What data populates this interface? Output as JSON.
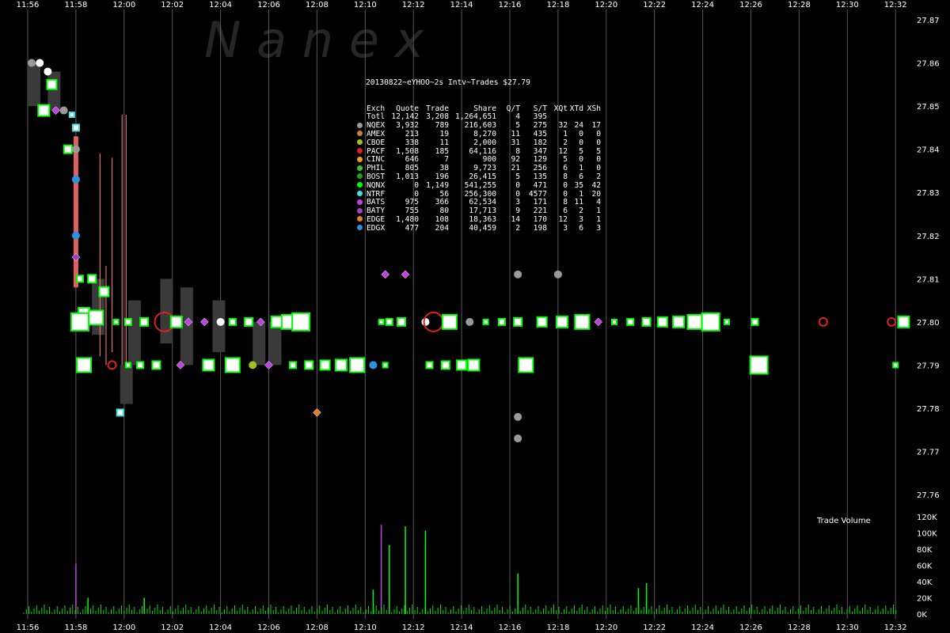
{
  "watermark": "N a n e x",
  "stats": {
    "title": "20130822~eYHOO~2s Intv~Trades $27.79",
    "columns": [
      "Exch",
      "Quote",
      "Trade",
      "Share",
      "Q/T",
      "S/T",
      "XQt",
      "XTd",
      "XSh"
    ],
    "rows": [
      {
        "exch": "Totl",
        "color": "",
        "quote": "12,142",
        "trade": "3,208",
        "share": "1,264,651",
        "qt": "4",
        "st": "395",
        "xqt": "",
        "xtd": "",
        "xsh": ""
      },
      {
        "exch": "NQEX",
        "color": "#9a9a9a",
        "quote": "3,932",
        "trade": "789",
        "share": "216,603",
        "qt": "5",
        "st": "275",
        "xqt": "32",
        "xtd": "24",
        "xsh": "17"
      },
      {
        "exch": "AMEX",
        "color": "#c08040",
        "quote": "213",
        "trade": "19",
        "share": "8,270",
        "qt": "11",
        "st": "435",
        "xqt": "1",
        "xtd": "0",
        "xsh": "0"
      },
      {
        "exch": "CBOE",
        "color": "#a0c020",
        "quote": "338",
        "trade": "11",
        "share": "2,000",
        "qt": "31",
        "st": "182",
        "xqt": "2",
        "xtd": "0",
        "xsh": "0"
      },
      {
        "exch": "PACF",
        "color": "#e02020",
        "quote": "1,508",
        "trade": "185",
        "share": "64,116",
        "qt": "8",
        "st": "347",
        "xqt": "12",
        "xtd": "5",
        "xsh": "5"
      },
      {
        "exch": "CINC",
        "color": "#f0a020",
        "quote": "646",
        "trade": "7",
        "share": "900",
        "qt": "92",
        "st": "129",
        "xqt": "5",
        "xtd": "0",
        "xsh": "0"
      },
      {
        "exch": "PHIL",
        "color": "#40c040",
        "quote": "805",
        "trade": "38",
        "share": "9,723",
        "qt": "21",
        "st": "256",
        "xqt": "6",
        "xtd": "1",
        "xsh": "0"
      },
      {
        "exch": "BOST",
        "color": "#20a020",
        "quote": "1,013",
        "trade": "196",
        "share": "26,415",
        "qt": "5",
        "st": "135",
        "xqt": "8",
        "xtd": "6",
        "xsh": "2"
      },
      {
        "exch": "NQNX",
        "color": "#00ff00",
        "quote": "0",
        "trade": "1,149",
        "share": "541,255",
        "qt": "0",
        "st": "471",
        "xqt": "0",
        "xtd": "35",
        "xsh": "42"
      },
      {
        "exch": "NTRF",
        "color": "#40e0e0",
        "quote": "0",
        "trade": "56",
        "share": "256,300",
        "qt": "0",
        "st": "4577",
        "xqt": "0",
        "xtd": "1",
        "xsh": "20"
      },
      {
        "exch": "BATS",
        "color": "#c040e0",
        "quote": "975",
        "trade": "366",
        "share": "62,534",
        "qt": "3",
        "st": "171",
        "xqt": "8",
        "xtd": "11",
        "xsh": "4"
      },
      {
        "exch": "BATY",
        "color": "#a040c0",
        "quote": "755",
        "trade": "80",
        "share": "17,713",
        "qt": "9",
        "st": "221",
        "xqt": "6",
        "xtd": "2",
        "xsh": "1"
      },
      {
        "exch": "EDGE",
        "color": "#e08020",
        "quote": "1,480",
        "trade": "108",
        "share": "18,363",
        "qt": "14",
        "st": "170",
        "xqt": "12",
        "xtd": "3",
        "xsh": "1"
      },
      {
        "exch": "EDGX",
        "color": "#3090e0",
        "quote": "477",
        "trade": "204",
        "share": "40,459",
        "qt": "2",
        "st": "198",
        "xqt": "3",
        "xtd": "6",
        "xsh": "3"
      }
    ]
  },
  "chart_data": {
    "type": "scatter",
    "title": "",
    "x_ticks": [
      "11:56",
      "11:58",
      "12:00",
      "12:02",
      "12:04",
      "12:06",
      "12:08",
      "12:10",
      "12:12",
      "12:14",
      "12:16",
      "12:18",
      "12:20",
      "12:22",
      "12:24",
      "12:26",
      "12:28",
      "12:30",
      "12:32"
    ],
    "y_ticks": [
      "27.87",
      "27.86",
      "27.85",
      "27.84",
      "27.83",
      "27.82",
      "27.81",
      "27.80",
      "27.79",
      "27.78",
      "27.77",
      "27.76"
    ],
    "ylim": [
      27.76,
      27.87
    ],
    "volume_title": "Trade Volume",
    "volume_ticks": [
      "120K",
      "100K",
      "80K",
      "60K",
      "40K",
      "20K",
      "0K"
    ],
    "volume_ylim": [
      0,
      120000
    ],
    "trades": [
      {
        "t": "11:56:10",
        "p": 27.86,
        "c": "#9a9a9a"
      },
      {
        "t": "11:56:30",
        "p": 27.86,
        "c": "#ffffff"
      },
      {
        "t": "11:56:50",
        "p": 27.858,
        "c": "#ffffff"
      },
      {
        "t": "11:57:00",
        "p": 27.855,
        "c": "#00ff00"
      },
      {
        "t": "11:56:40",
        "p": 27.849,
        "c": "#00ff00"
      },
      {
        "t": "11:57:10",
        "p": 27.849,
        "c": "#c040e0"
      },
      {
        "t": "11:57:30",
        "p": 27.849,
        "c": "#9a9a9a"
      },
      {
        "t": "11:57:50",
        "p": 27.848,
        "c": "#40e0e0"
      },
      {
        "t": "11:58:00",
        "p": 27.845,
        "c": "#40e0e0"
      },
      {
        "t": "11:57:40",
        "p": 27.84,
        "c": "#00ff00"
      },
      {
        "t": "11:58:00",
        "p": 27.84,
        "c": "#9a9a9a"
      },
      {
        "t": "11:58:00",
        "p": 27.833,
        "c": "#c040e0"
      },
      {
        "t": "11:58:00",
        "p": 27.833,
        "c": "#3090e0"
      },
      {
        "t": "11:58:00",
        "p": 27.82,
        "c": "#3090e0"
      },
      {
        "t": "11:58:00",
        "p": 27.815,
        "c": "#a040c0"
      },
      {
        "t": "11:58:10",
        "p": 27.81,
        "c": "#00ff00"
      },
      {
        "t": "11:58:40",
        "p": 27.81,
        "c": "#00ff00"
      },
      {
        "t": "11:59:10",
        "p": 27.807,
        "c": "#00ff00"
      },
      {
        "t": "11:58:20",
        "p": 27.802,
        "c": "#00ff00"
      },
      {
        "t": "11:58:50",
        "p": 27.801,
        "c": "#00ff00"
      },
      {
        "t": "11:58:10",
        "p": 27.8,
        "c": "#00ff00"
      },
      {
        "t": "11:59:40",
        "p": 27.8,
        "c": "#00ff00"
      },
      {
        "t": "12:00:10",
        "p": 27.8,
        "c": "#00ff00"
      },
      {
        "t": "12:00:50",
        "p": 27.8,
        "c": "#00ff00"
      },
      {
        "t": "12:01:40",
        "p": 27.8,
        "c": "#e02020"
      },
      {
        "t": "12:02:10",
        "p": 27.8,
        "c": "#00ff00"
      },
      {
        "t": "12:02:40",
        "p": 27.8,
        "c": "#c040e0"
      },
      {
        "t": "12:03:20",
        "p": 27.8,
        "c": "#c040e0"
      },
      {
        "t": "12:04:00",
        "p": 27.8,
        "c": "#ffffff"
      },
      {
        "t": "12:04:30",
        "p": 27.8,
        "c": "#00ff00"
      },
      {
        "t": "12:05:10",
        "p": 27.8,
        "c": "#00ff00"
      },
      {
        "t": "12:05:40",
        "p": 27.8,
        "c": "#c040e0"
      },
      {
        "t": "12:06:20",
        "p": 27.8,
        "c": "#00ff00"
      },
      {
        "t": "12:06:50",
        "p": 27.8,
        "c": "#00ff00"
      },
      {
        "t": "12:07:20",
        "p": 27.8,
        "c": "#00ff00"
      },
      {
        "t": "12:10:40",
        "p": 27.8,
        "c": "#00ff00"
      },
      {
        "t": "12:11:00",
        "p": 27.8,
        "c": "#00ff00"
      },
      {
        "t": "12:11:30",
        "p": 27.8,
        "c": "#00ff00"
      },
      {
        "t": "12:12:30",
        "p": 27.8,
        "c": "#ffffff"
      },
      {
        "t": "12:12:50",
        "p": 27.8,
        "c": "#e02020"
      },
      {
        "t": "12:13:30",
        "p": 27.8,
        "c": "#00ff00"
      },
      {
        "t": "12:14:20",
        "p": 27.8,
        "c": "#9a9a9a"
      },
      {
        "t": "12:15:00",
        "p": 27.8,
        "c": "#00ff00"
      },
      {
        "t": "12:15:40",
        "p": 27.8,
        "c": "#00ff00"
      },
      {
        "t": "12:16:20",
        "p": 27.8,
        "c": "#00ff00"
      },
      {
        "t": "12:17:20",
        "p": 27.8,
        "c": "#00ff00"
      },
      {
        "t": "12:18:10",
        "p": 27.8,
        "c": "#00ff00"
      },
      {
        "t": "12:19:00",
        "p": 27.8,
        "c": "#00ff00"
      },
      {
        "t": "12:19:40",
        "p": 27.8,
        "c": "#c040e0"
      },
      {
        "t": "12:20:20",
        "p": 27.8,
        "c": "#00ff00"
      },
      {
        "t": "12:21:00",
        "p": 27.8,
        "c": "#00ff00"
      },
      {
        "t": "12:21:40",
        "p": 27.8,
        "c": "#00ff00"
      },
      {
        "t": "12:22:20",
        "p": 27.8,
        "c": "#00ff00"
      },
      {
        "t": "12:23:00",
        "p": 27.8,
        "c": "#00ff00"
      },
      {
        "t": "12:23:40",
        "p": 27.8,
        "c": "#00ff00"
      },
      {
        "t": "12:24:20",
        "p": 27.8,
        "c": "#00ff00"
      },
      {
        "t": "12:25:00",
        "p": 27.8,
        "c": "#00ff00"
      },
      {
        "t": "12:26:10",
        "p": 27.8,
        "c": "#00ff00"
      },
      {
        "t": "12:29:00",
        "p": 27.8,
        "c": "#e02020"
      },
      {
        "t": "12:31:50",
        "p": 27.8,
        "c": "#e02020"
      },
      {
        "t": "12:32:20",
        "p": 27.8,
        "c": "#00ff00"
      },
      {
        "t": "11:58:20",
        "p": 27.79,
        "c": "#00ff00"
      },
      {
        "t": "11:59:30",
        "p": 27.79,
        "c": "#e02020"
      },
      {
        "t": "12:00:10",
        "p": 27.79,
        "c": "#00ff00"
      },
      {
        "t": "12:00:40",
        "p": 27.79,
        "c": "#00ff00"
      },
      {
        "t": "12:01:20",
        "p": 27.79,
        "c": "#00ff00"
      },
      {
        "t": "12:02:20",
        "p": 27.79,
        "c": "#c040e0"
      },
      {
        "t": "12:03:30",
        "p": 27.79,
        "c": "#00ff00"
      },
      {
        "t": "12:04:30",
        "p": 27.79,
        "c": "#00ff00"
      },
      {
        "t": "12:05:20",
        "p": 27.79,
        "c": "#a0c020"
      },
      {
        "t": "12:06:00",
        "p": 27.79,
        "c": "#c040e0"
      },
      {
        "t": "12:07:00",
        "p": 27.79,
        "c": "#00ff00"
      },
      {
        "t": "12:07:40",
        "p": 27.79,
        "c": "#00ff00"
      },
      {
        "t": "12:08:20",
        "p": 27.79,
        "c": "#00ff00"
      },
      {
        "t": "12:09:00",
        "p": 27.79,
        "c": "#00ff00"
      },
      {
        "t": "12:09:40",
        "p": 27.79,
        "c": "#00ff00"
      },
      {
        "t": "12:10:20",
        "p": 27.79,
        "c": "#3090e0"
      },
      {
        "t": "12:10:50",
        "p": 27.79,
        "c": "#00ff00"
      },
      {
        "t": "12:12:40",
        "p": 27.79,
        "c": "#00ff00"
      },
      {
        "t": "12:13:20",
        "p": 27.79,
        "c": "#00ff00"
      },
      {
        "t": "12:14:00",
        "p": 27.79,
        "c": "#00ff00"
      },
      {
        "t": "12:14:30",
        "p": 27.79,
        "c": "#00ff00"
      },
      {
        "t": "12:16:40",
        "p": 27.79,
        "c": "#00ff00"
      },
      {
        "t": "12:26:20",
        "p": 27.79,
        "c": "#00ff00"
      },
      {
        "t": "12:32:00",
        "p": 27.79,
        "c": "#00ff00"
      },
      {
        "t": "11:59:50",
        "p": 27.779,
        "c": "#40e0e0"
      },
      {
        "t": "12:08:00",
        "p": 27.779,
        "c": "#e08020"
      },
      {
        "t": "12:16:20",
        "p": 27.778,
        "c": "#9a9a9a"
      },
      {
        "t": "12:16:20",
        "p": 27.773,
        "c": "#9a9a9a"
      },
      {
        "t": "12:10:50",
        "p": 27.811,
        "c": "#c040e0"
      },
      {
        "t": "12:11:40",
        "p": 27.811,
        "c": "#c040e0"
      },
      {
        "t": "12:16:20",
        "p": 27.811,
        "c": "#9a9a9a"
      },
      {
        "t": "12:18:00",
        "p": 27.811,
        "c": "#9a9a9a"
      }
    ]
  }
}
